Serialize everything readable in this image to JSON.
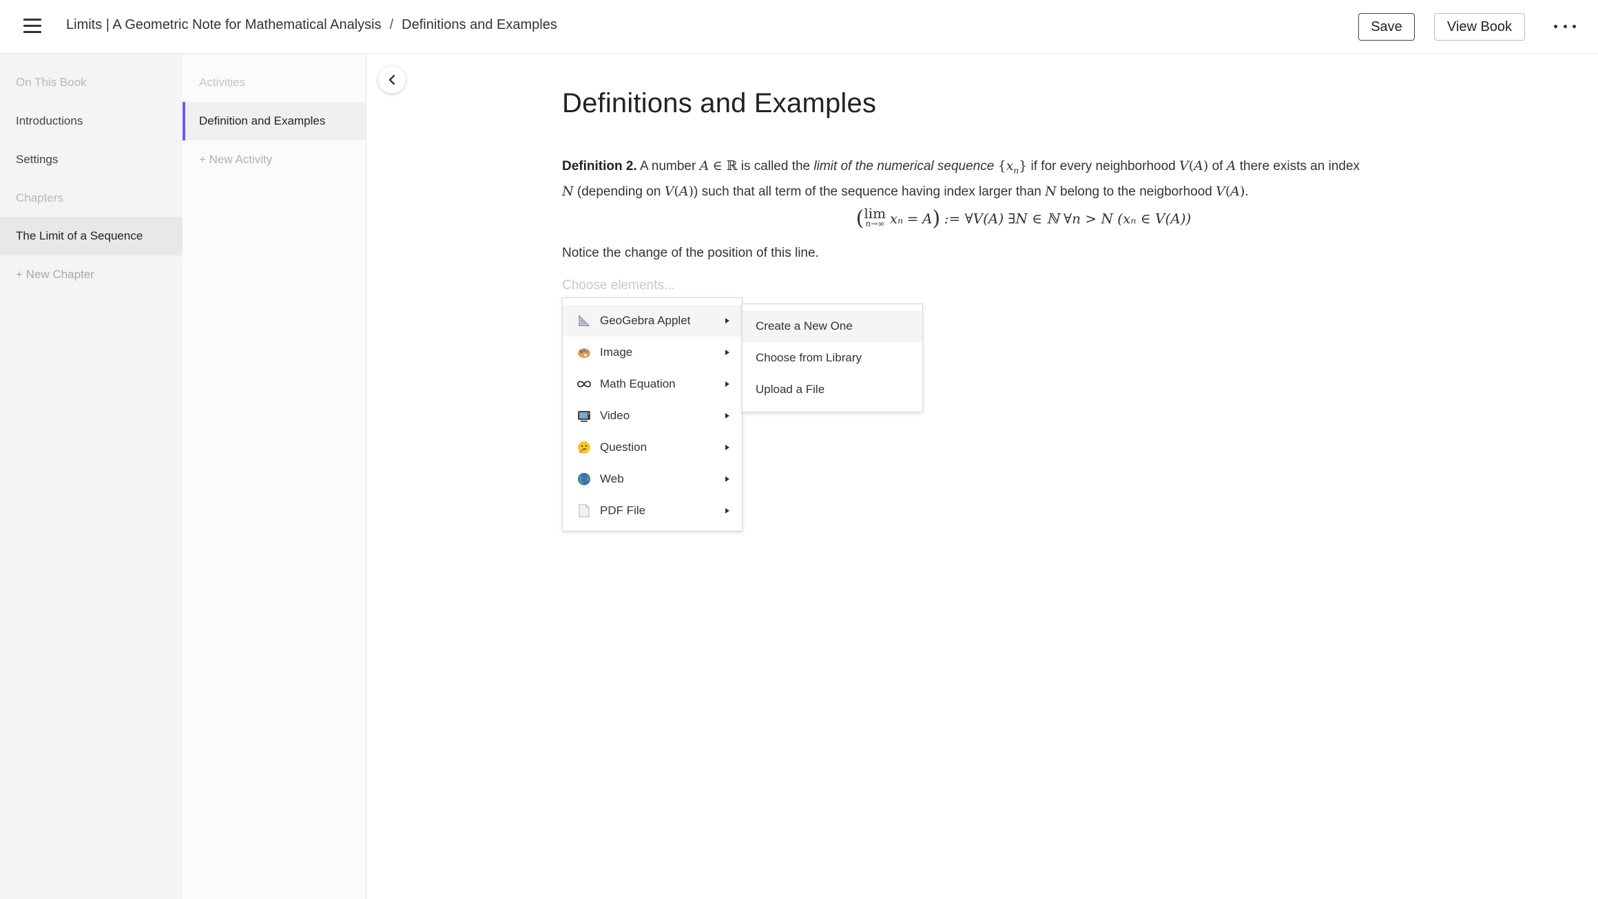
{
  "header": {
    "breadcrumb": [
      "Limits | A Geometric Note for Mathematical Analysis",
      "Definitions and Examples"
    ],
    "separator": "/",
    "save_label": "Save",
    "view_book_label": "View Book"
  },
  "sidebar": {
    "items": [
      {
        "label": "On This Book",
        "kind": "section"
      },
      {
        "label": "Introductions",
        "kind": "item"
      },
      {
        "label": "Settings",
        "kind": "item"
      },
      {
        "label": "Chapters",
        "kind": "section"
      },
      {
        "label": "The Limit of a Sequence",
        "kind": "active"
      },
      {
        "label": "+ New Chapter",
        "kind": "add"
      }
    ]
  },
  "activities": {
    "items": [
      {
        "label": "Activities",
        "kind": "section"
      },
      {
        "label": "Definition and Examples",
        "kind": "active"
      },
      {
        "label": "+ New Activity",
        "kind": "add"
      }
    ],
    "accent_color": "#6b5ce7"
  },
  "content": {
    "title": "Definitions and Examples",
    "definition": {
      "label": "Definition 2.",
      "t1": "A number",
      "t2": "is called the",
      "italic": "limit of the numerical sequence",
      "t3": "if for every neighborhood",
      "t4": "of",
      "t5": "there exists an index",
      "t6": "(depending on",
      "t7": ") such that all term of the sequence having index larger than",
      "t8": "belong to the neigborhood",
      "t9": "."
    },
    "equation": {
      "lim": "lim",
      "lim_sub": "n→∞",
      "rest": ":= ∀V(A) ∃N ∈ ℕ ∀n > N (xₙ ∈ V(A))"
    },
    "notice": "Notice the change of the position of this line.",
    "choose_placeholder": "Choose elements..."
  },
  "element_menu": {
    "items": [
      {
        "label": "GeoGebra Applet",
        "icon": "triangle-ruler-icon"
      },
      {
        "label": "Image",
        "icon": "palette-icon"
      },
      {
        "label": "Math Equation",
        "icon": "infinity-icon"
      },
      {
        "label": "Video",
        "icon": "tv-icon"
      },
      {
        "label": "Question",
        "icon": "thinking-face-icon"
      },
      {
        "label": "Web",
        "icon": "globe-icon"
      },
      {
        "label": "PDF File",
        "icon": "document-icon"
      }
    ]
  },
  "geogebra_submenu": {
    "items": [
      "Create a New One",
      "Choose from Library",
      "Upload a File"
    ]
  }
}
